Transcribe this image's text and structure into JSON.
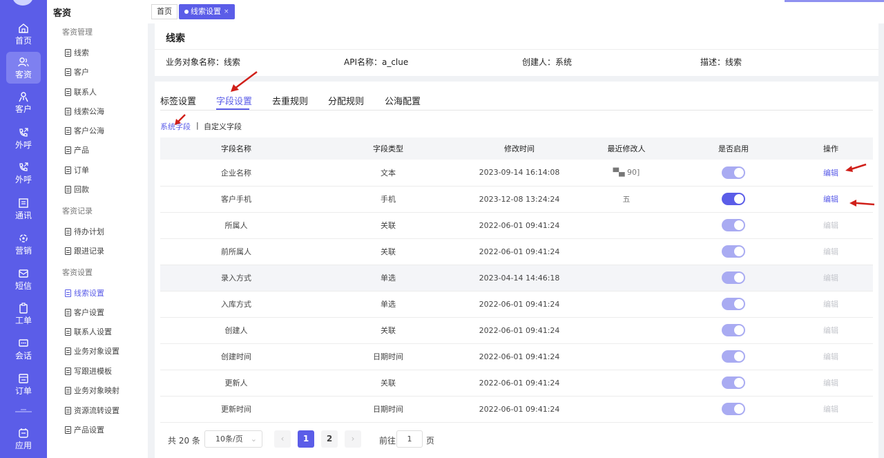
{
  "rail": {
    "items": [
      {
        "label": "首页",
        "icon": "home-icon"
      },
      {
        "label": "客资",
        "icon": "users-icon"
      },
      {
        "label": "客户",
        "icon": "user-icon"
      },
      {
        "label": "外呼",
        "icon": "phone-out-icon"
      },
      {
        "label": "外呼",
        "icon": "phone-out-icon"
      },
      {
        "label": "通讯",
        "icon": "contacts-icon"
      },
      {
        "label": "营销",
        "icon": "marketing-icon"
      },
      {
        "label": "短信",
        "icon": "sms-icon"
      },
      {
        "label": "工单",
        "icon": "clipboard-icon"
      },
      {
        "label": "会话",
        "icon": "chat-icon"
      },
      {
        "label": "订单",
        "icon": "order-icon"
      },
      {
        "label": "应用",
        "icon": "app-icon"
      }
    ],
    "bg_color": "#5b5de8"
  },
  "sidebar": {
    "title": "客资",
    "groups": [
      {
        "label": "客资管理",
        "items": [
          "线索",
          "客户",
          "联系人",
          "线索公海",
          "客户公海",
          "产品",
          "订单",
          "回款"
        ]
      },
      {
        "label": "客资记录",
        "items": [
          "待办计划",
          "跟进记录"
        ]
      },
      {
        "label": "客资设置",
        "items": [
          "线索设置",
          "客户设置",
          "联系人设置",
          "业务对象设置",
          "写跟进模板",
          "业务对象映射",
          "资源流转设置",
          "产品设置"
        ]
      }
    ],
    "active_item": "线索设置"
  },
  "tabs": {
    "home": "首页",
    "current": "线索设置",
    "close": "×"
  },
  "header": {
    "title": "线索",
    "meta": [
      "业务对象名称：线索",
      "API名称：a_clue",
      "创建人：系统",
      "描述：线索"
    ]
  },
  "main": {
    "tabs": [
      "标签设置",
      "字段设置",
      "去重规则",
      "分配规则",
      "公海配置"
    ],
    "active_tab": "字段设置",
    "sub_links": [
      "系统字段",
      "自定义字段"
    ],
    "separator": "|",
    "columns": [
      "字段名称",
      "字段类型",
      "修改时间",
      "最近修改人",
      "是否启用",
      "操作"
    ],
    "rows": [
      {
        "name": "企业名称",
        "type": "文本",
        "time": "2023-09-14 16:14:08",
        "modifier": "▀▄ 90]",
        "enabled": true,
        "action": "编辑",
        "editable": true
      },
      {
        "name": "客户手机",
        "type": "手机",
        "time": "2023-12-08 13:24:24",
        "modifier": "五",
        "enabled": true,
        "action": "编辑",
        "editable": true
      },
      {
        "name": "所属人",
        "type": "关联",
        "time": "2022-06-01 09:41:24",
        "modifier": "",
        "enabled": true,
        "action": "编辑",
        "editable": false
      },
      {
        "name": "前所属人",
        "type": "关联",
        "time": "2022-06-01 09:41:24",
        "modifier": "",
        "enabled": true,
        "action": "编辑",
        "editable": false
      },
      {
        "name": "录入方式",
        "type": "单选",
        "time": "2023-04-14 14:46:18",
        "modifier": "",
        "enabled": true,
        "action": "编辑",
        "editable": false
      },
      {
        "name": "入库方式",
        "type": "单选",
        "time": "2022-06-01 09:41:24",
        "modifier": "",
        "enabled": true,
        "action": "编辑",
        "editable": false
      },
      {
        "name": "创建人",
        "type": "关联",
        "time": "2022-06-01 09:41:24",
        "modifier": "",
        "enabled": true,
        "action": "编辑",
        "editable": false
      },
      {
        "name": "创建时间",
        "type": "日期时间",
        "time": "2022-06-01 09:41:24",
        "modifier": "",
        "enabled": true,
        "action": "编辑",
        "editable": false
      },
      {
        "name": "更新人",
        "type": "关联",
        "time": "2022-06-01 09:41:24",
        "modifier": "",
        "enabled": true,
        "action": "编辑",
        "editable": false
      },
      {
        "name": "更新时间",
        "type": "日期时间",
        "time": "2022-06-01 09:41:24",
        "modifier": "",
        "enabled": true,
        "action": "编辑",
        "editable": false
      }
    ]
  },
  "pagination": {
    "total": "共 20 条",
    "page_size": "10条/页",
    "pages": [
      "1",
      "2"
    ],
    "current_page": "1",
    "prev": "‹",
    "next": "›",
    "goto_label": "前往",
    "goto_value": "1",
    "goto_unit": "页"
  },
  "colors": {
    "accent": "#5b5de8",
    "annotation_red": "#d0201a"
  }
}
